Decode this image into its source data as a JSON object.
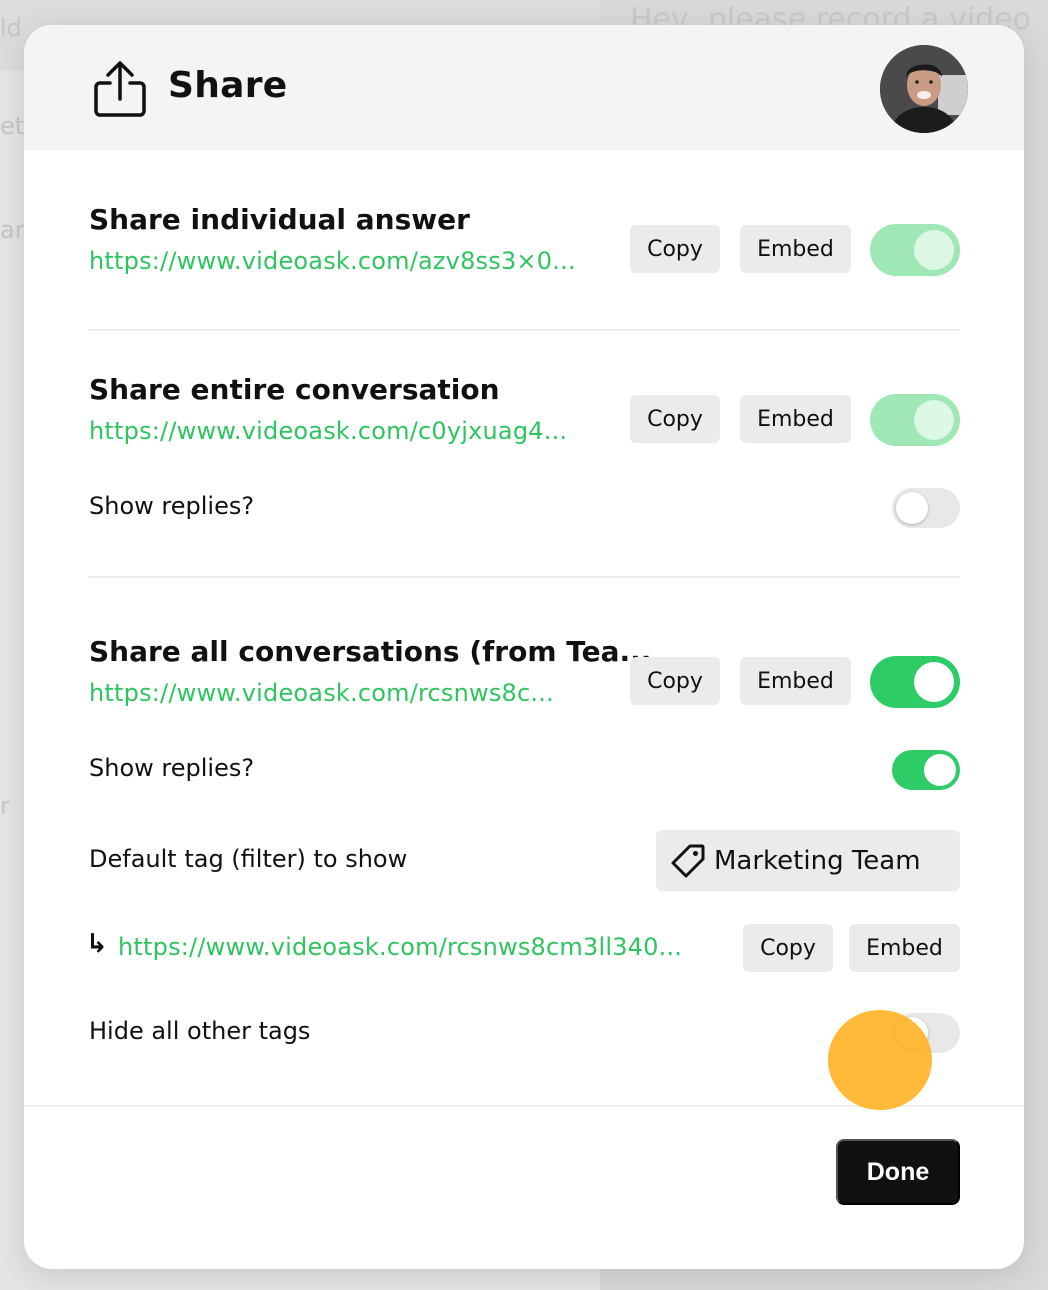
{
  "background": {
    "caption": "Hey, please record a video",
    "letters": [
      "ld",
      "et",
      "an",
      "r"
    ]
  },
  "modal": {
    "title": "Share",
    "icons": {
      "share": "share-upload-icon",
      "avatar": "user-avatar",
      "tag": "tag-icon",
      "arrow": "return-arrow-icon"
    }
  },
  "sections": {
    "individual": {
      "title": "Share individual answer",
      "link": "https://www.videoask.com/azv8ss3×0...",
      "copy_label": "Copy",
      "embed_label": "Embed",
      "enabled": true
    },
    "conversation": {
      "title": "Share entire conversation",
      "link": "https://www.videoask.com/c0yjxuag4...",
      "copy_label": "Copy",
      "embed_label": "Embed",
      "enabled": true,
      "show_replies_label": "Show replies?",
      "show_replies": false
    },
    "all": {
      "title": "Share all conversations (from Tea...",
      "link": "https://www.videoask.com/rcsnws8c...",
      "copy_label": "Copy",
      "embed_label": "Embed",
      "enabled": true,
      "show_replies_label": "Show replies?",
      "show_replies": true,
      "default_tag_label": "Default tag (filter) to show",
      "default_tag_value": "Marketing Team",
      "arrow": "↳",
      "tag_link": "https://www.videoask.com/rcsnws8cm3ll340...",
      "tag_copy_label": "Copy",
      "tag_embed_label": "Embed",
      "hide_tags_label": "Hide all other tags",
      "hide_tags": false
    }
  },
  "footer": {
    "done_label": "Done"
  },
  "colors": {
    "accent_green": "#2ecc67",
    "link_green": "#2fc460",
    "cursor": "#ffb01e"
  }
}
